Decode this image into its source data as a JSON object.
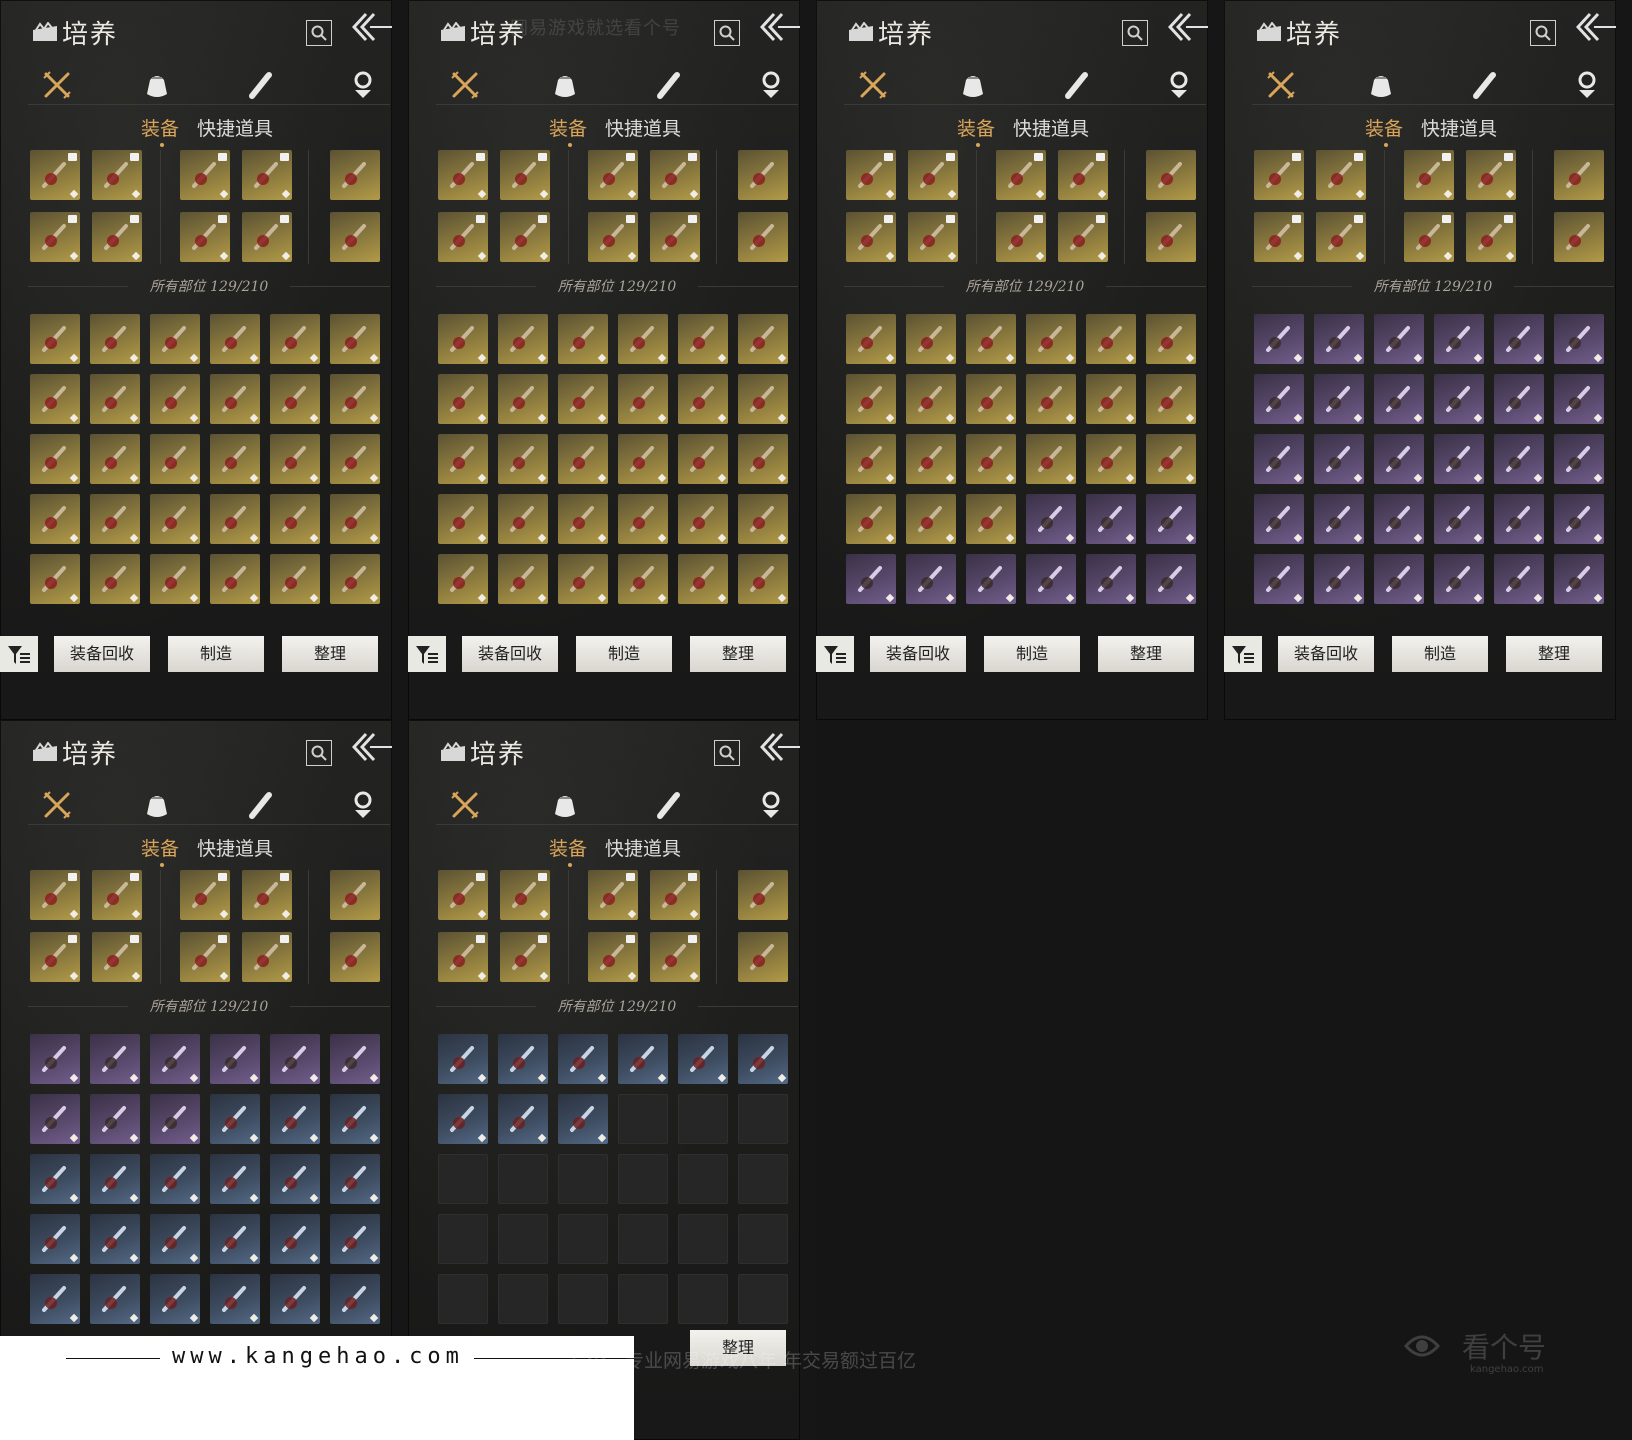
{
  "panel": {
    "title": "培养",
    "tabs": [
      "装备",
      "快捷道具"
    ],
    "count_label": "所有部位 129/210",
    "buttons": [
      "装备回收",
      "制造",
      "整理"
    ]
  },
  "categories": [
    "weapon-crossed-swords-icon",
    "pouch-icon",
    "scroll-icon",
    "token-icon"
  ],
  "panel_count": 6,
  "panel5_last_button": "整理",
  "watermark_top": "网易游戏就选看个号",
  "footer": {
    "url": "www.kangehao.com",
    "slogan": "看个号专业网易游戏八年   年交易额过百亿",
    "logo_text": "看个号",
    "logo_sub": "kangehao.com"
  },
  "colors": {
    "accent": "#d9a55b",
    "gold_rarity": "#b29a48",
    "purple_rarity": "#735e8c",
    "blue_rarity": "#546a86"
  },
  "grids": [
    [
      "g",
      "g",
      "g",
      "g",
      "g",
      "g",
      "g",
      "g",
      "g",
      "g",
      "g",
      "g",
      "g",
      "g",
      "g",
      "g",
      "g",
      "g",
      "g",
      "g",
      "g",
      "g",
      "g",
      "g",
      "g",
      "g",
      "g",
      "g",
      "g",
      "g"
    ],
    [
      "g",
      "g",
      "g",
      "g",
      "g",
      "g",
      "g",
      "g",
      "g",
      "g",
      "g",
      "g",
      "g",
      "g",
      "g",
      "g",
      "g",
      "g",
      "g",
      "g",
      "g",
      "g",
      "g",
      "g",
      "g",
      "g",
      "g",
      "g",
      "g",
      "g"
    ],
    [
      "g",
      "g",
      "g",
      "g",
      "g",
      "g",
      "g",
      "g",
      "g",
      "g",
      "g",
      "g",
      "g",
      "g",
      "g",
      "g",
      "g",
      "g",
      "g",
      "g",
      "g",
      "p",
      "p",
      "p",
      "p",
      "p",
      "p",
      "p",
      "p",
      "p"
    ],
    [
      "p",
      "p",
      "p",
      "p",
      "p",
      "p",
      "p",
      "p",
      "p",
      "p",
      "p",
      "p",
      "p",
      "p",
      "p",
      "p",
      "p",
      "p",
      "p",
      "p",
      "p",
      "p",
      "p",
      "p",
      "p",
      "p",
      "p",
      "p",
      "p",
      "p"
    ],
    [
      "p",
      "p",
      "p",
      "p",
      "p",
      "p",
      "p",
      "p",
      "p",
      "b",
      "b",
      "b",
      "b",
      "b",
      "b",
      "b",
      "b",
      "b",
      "b",
      "b",
      "b",
      "b",
      "b",
      "b",
      "b",
      "b",
      "b",
      "b",
      "b",
      "b"
    ],
    [
      "b",
      "b",
      "b",
      "b",
      "b",
      "b",
      "b",
      "b",
      "b",
      "e",
      "e",
      "e",
      "e",
      "e",
      "e",
      "e",
      "e",
      "e",
      "e",
      "e",
      "e",
      "e",
      "e",
      "e",
      "e",
      "e",
      "e",
      "e",
      "e",
      "e"
    ]
  ]
}
